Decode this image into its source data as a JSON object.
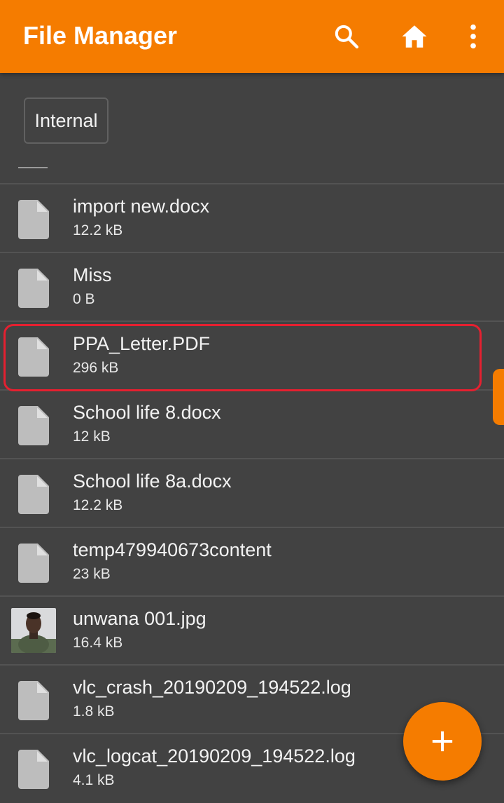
{
  "toolbar": {
    "title": "File Manager",
    "icons": [
      "search-icon",
      "home-icon",
      "more-vert-icon"
    ],
    "accent": "#f57c00"
  },
  "breadcrumb": {
    "current": "Internal"
  },
  "files": [
    {
      "name": "import new.docx",
      "size": "12.2 kB",
      "icon": "file-icon"
    },
    {
      "name": "Miss",
      "size": "0 B",
      "icon": "file-icon"
    },
    {
      "name": "PPA_Letter.PDF",
      "size": "296 kB",
      "icon": "file-icon",
      "highlighted": true
    },
    {
      "name": "School life 8.docx",
      "size": "12 kB",
      "icon": "file-icon"
    },
    {
      "name": "School life 8a.docx",
      "size": "12.2 kB",
      "icon": "file-icon"
    },
    {
      "name": "temp479940673content",
      "size": "23 kB",
      "icon": "file-icon"
    },
    {
      "name": "unwana 001.jpg",
      "size": "16.4 kB",
      "icon": "image-thumbnail"
    },
    {
      "name": "vlc_crash_20190209_194522.log",
      "size": "1.8 kB",
      "icon": "file-icon"
    },
    {
      "name": "vlc_logcat_20190209_194522.log",
      "size": "4.1 kB",
      "icon": "file-icon"
    }
  ],
  "fab": {
    "icon": "plus-icon"
  },
  "colors": {
    "background": "#424242",
    "highlight": "#e52030",
    "file_icon": "#bdbdbd"
  }
}
